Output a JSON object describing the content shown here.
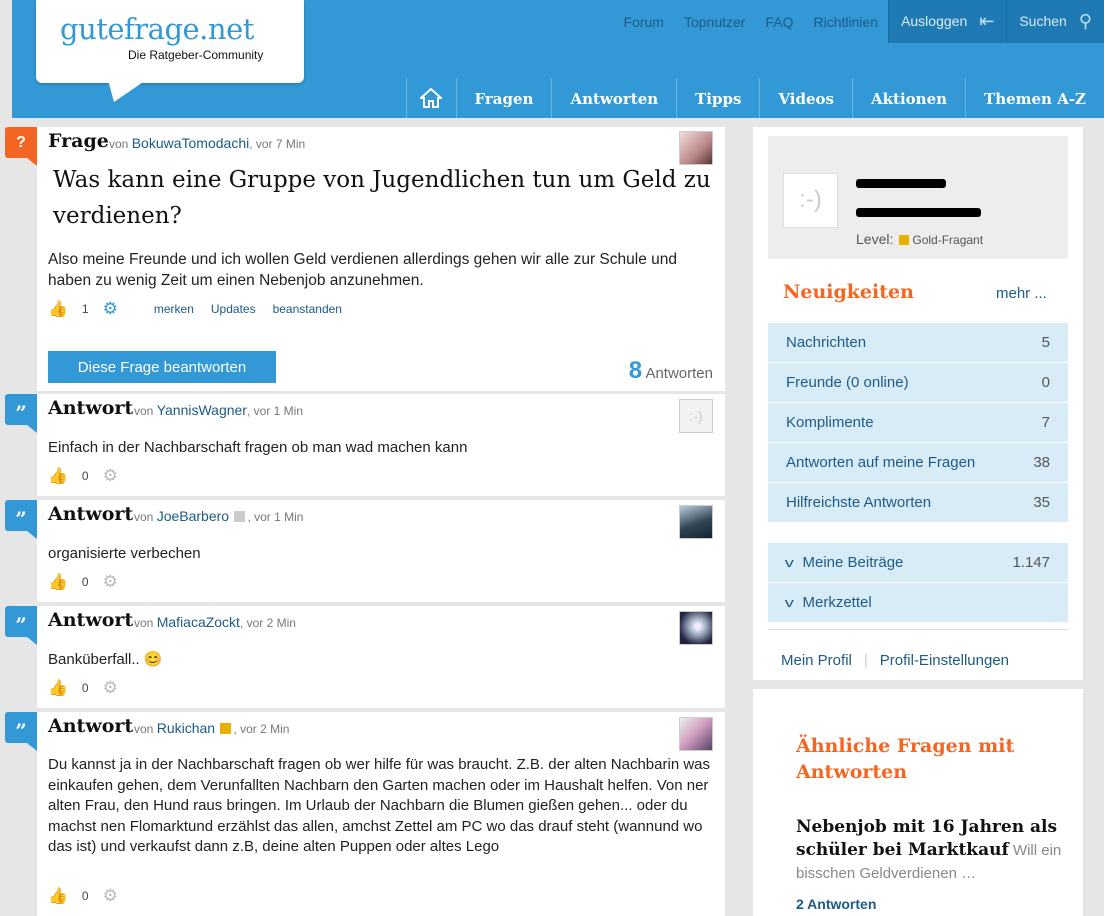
{
  "logo": {
    "name": "gutefrage.net",
    "tagline": "Die Ratgeber-Community"
  },
  "topnav": {
    "forum": "Forum",
    "topnutzer": "Topnutzer",
    "faq": "FAQ",
    "richtlinien": "Richtlinien",
    "logout": "Ausloggen",
    "search": "Suchen"
  },
  "mainnav": {
    "fragen": "Fragen",
    "antworten": "Antworten",
    "tipps": "Tipps",
    "videos": "Videos",
    "aktionen": "Aktionen",
    "themen": "Themen A-Z"
  },
  "question": {
    "kind": "Frage",
    "von": "von",
    "user": "BokuwaTomodachi",
    "time": ", vor 7 Min",
    "title": "Was kann eine Gruppe von Jugendlichen tun um Geld zu verdienen?",
    "body": "Also meine Freunde und ich wollen Geld verdienen allerdings gehen wir alle zur Schule und haben zu wenig Zeit um einen Nebenjob anzunehmen.",
    "likes": "1",
    "merken": "merken",
    "updates": "Updates",
    "beanstanden": "beanstanden",
    "answer_button": "Diese Frage beantworten",
    "answer_count": "8",
    "answer_count_label": "Antworten"
  },
  "answers": [
    {
      "kind": "Antwort",
      "von": "von",
      "user": "YannisWagner",
      "time": ", vor 1 Min",
      "body": "Einfach in der Nachbarschaft fragen ob man wad machen kann",
      "likes": "0"
    },
    {
      "kind": "Antwort",
      "von": "von",
      "user": "JoeBarbero",
      "time": ", vor 1 Min",
      "body": "organisierte verbechen",
      "likes": "0"
    },
    {
      "kind": "Antwort",
      "von": "von",
      "user": "MafiacaZockt",
      "time": ", vor 2 Min",
      "body": "Banküberfall.. 😊",
      "likes": "0"
    },
    {
      "kind": "Antwort",
      "von": "von",
      "user": "Rukichan",
      "time": ", vor 2 Min",
      "body": "Du kannst ja in der Nachbarschaft fragen ob wer hilfe für was braucht. Z.B. der alten Nachbarin was einkaufen gehen, dem Verunfallten Nachbarn  den Garten machen oder im Haushalt helfen.  Von ner alten Frau, den Hund raus bringen. Im Urlaub der Nachbarn die Blumen gießen gehen... oder du machst nen Flomarktund erzählst das allen, amchst Zettel am PC wo das drauf steht (wannund wo das ist) und verkaufst dann z.B, deine alten Puppen oder altes Lego",
      "likes": "0"
    }
  ],
  "profile": {
    "level_label": "Level:",
    "level_value": "Gold-Fragant"
  },
  "news": {
    "title": "Neuigkeiten",
    "more": "mehr ...",
    "items": [
      {
        "label": "Nachrichten",
        "count": "5"
      },
      {
        "label": "Freunde (0 online)",
        "count": "0"
      },
      {
        "label": "Komplimente",
        "count": "7"
      },
      {
        "label": "Antworten auf meine Fragen",
        "count": "38"
      },
      {
        "label": "Hilfreichste Antworten",
        "count": "35"
      }
    ],
    "beitraege_label": "Meine Beiträge",
    "beitraege_count": "1.147",
    "merkzettel": "Merkzettel",
    "mein_profil": "Mein Profil",
    "einstellungen": "Profil-Einstellungen"
  },
  "similar": {
    "title": "Ähnliche Fragen mit Antworten",
    "question_title": "Nebenjob mit 16 Jahren als schüler bei Marktkauf",
    "question_snippet": "Will ein bisschen Geldverdienen …",
    "answers": "2 Antworten"
  }
}
